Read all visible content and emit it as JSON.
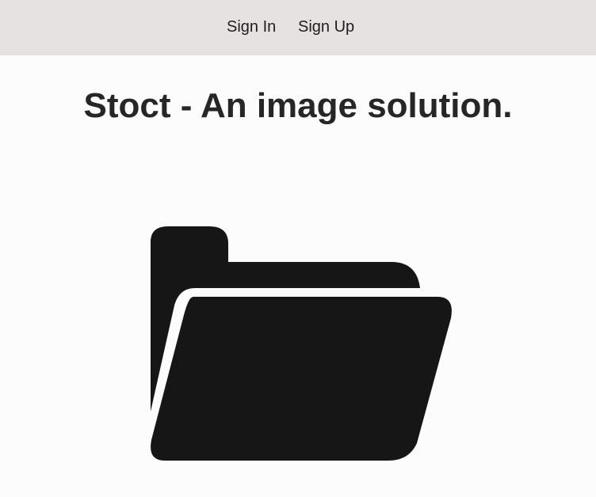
{
  "nav": {
    "sign_in": "Sign In",
    "sign_up": "Sign Up"
  },
  "main": {
    "title": "Stoct - An image solution.",
    "hero_icon": "folder-open-icon"
  },
  "colors": {
    "nav_background": "#e6e2e1",
    "page_background": "#fcfcfc",
    "icon_fill": "#161616",
    "text": "#222222"
  }
}
